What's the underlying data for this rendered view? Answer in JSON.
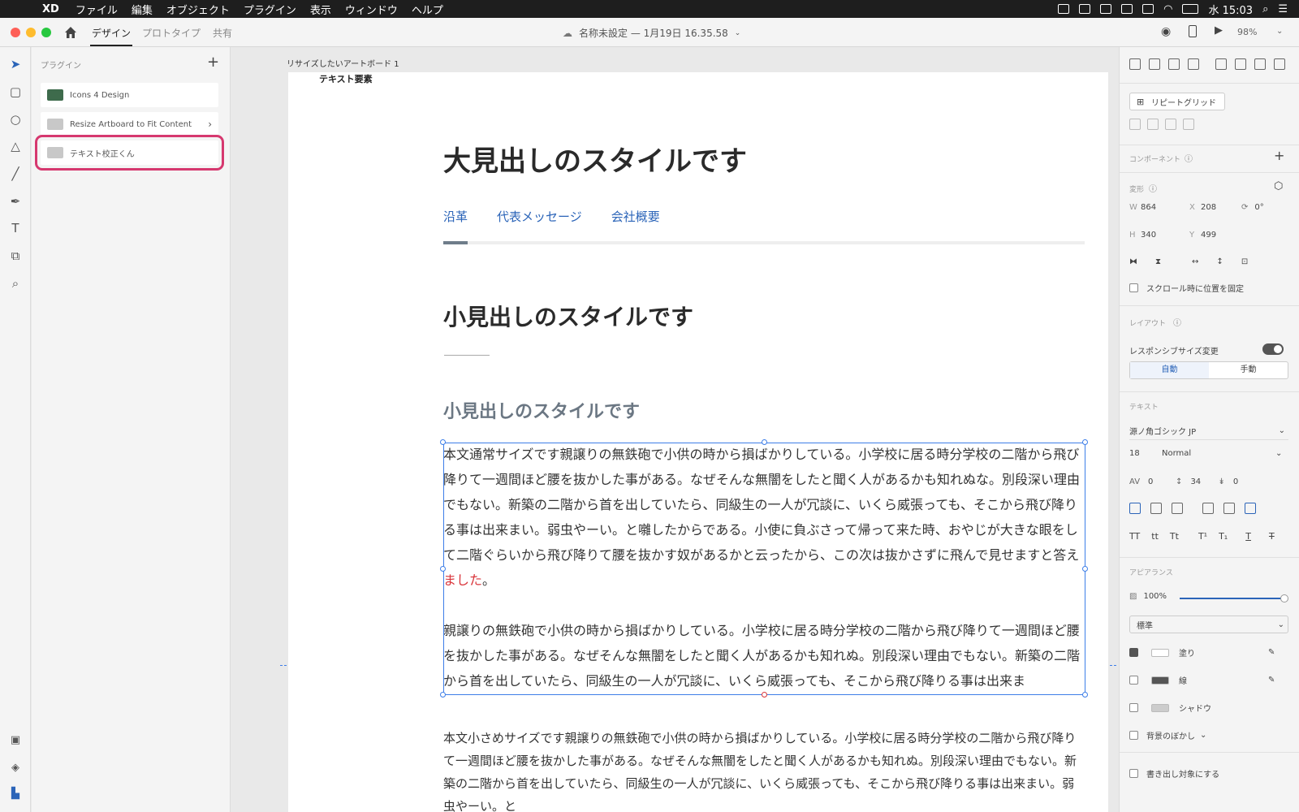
{
  "menubar": {
    "app": "XD",
    "items": [
      "ファイル",
      "編集",
      "オブジェクト",
      "プラグイン",
      "表示",
      "ウィンドウ",
      "ヘルプ"
    ],
    "clock": "水 15:03"
  },
  "titlebar": {
    "tabs": [
      "デザイン",
      "プロトタイプ",
      "共有"
    ],
    "doc_title": "名称未設定 — 1月19日 16.35.58",
    "zoom": "98%"
  },
  "plugins": {
    "header": "プラグイン",
    "items": [
      {
        "label": "Icons 4 Design"
      },
      {
        "label": "Resize Artboard to Fit Content",
        "chevron": "›"
      },
      {
        "label": "テキスト校正くん",
        "highlighted": true
      }
    ]
  },
  "canvas": {
    "artboard_label": "リサイズしたいアートボード 1",
    "text_element_label": "テキスト要素",
    "h1": "大見出しのスタイルです",
    "nav_links": [
      "沿革",
      "代表メッセージ",
      "会社概要"
    ],
    "h2": "小見出しのスタイルです",
    "h3": "小見出しのスタイルです",
    "body1_main": "本文通常サイズです親譲りの無鉄砲で小供の時から損ばかりしている。小学校に居る時分学校の二階から飛び降りて一週間ほど腰を抜かした事がある。なぜそんな無闇をしたと聞く人があるかも知れぬな。別段深い理由でもない。新築の二階から首を出していたら、同級生の一人が冗談に、いくら威張っても、そこから飛び降りる事は出来まい。弱虫やーい。と囃したからである。小使に負ぶさって帰って来た時、おやじが大きな眼をして二階ぐらいから飛び降りて腰を抜かす奴があるかと云ったから、この次は抜かさずに飛んで見せますと答え",
    "body1_red": "ました",
    "body1_end": "。",
    "body2": "親譲りの無鉄砲で小供の時から損ばかりしている。小学校に居る時分学校の二階から飛び降りて一週間ほど腰を抜かした事がある。なぜそんな無闇をしたと聞く人があるかも知れぬ。別段深い理由でもない。新築の二階から首を出していたら、同級生の一人が冗談に、いくら威張っても、そこから飛び降りる事は出来ま",
    "body_small": "本文小さめサイズです親譲りの無鉄砲で小供の時から損ばかりしている。小学校に居る時分学校の二階から飛び降りて一週間ほど腰を抜かした事がある。なぜそんな無闇をしたと聞く人があるかも知れぬ。別段深い理由でもない。新築の二階から首を出していたら、同級生の一人が冗談に、いくら威張っても、そこから飛び降りる事は出来まい。弱虫やーい。と"
  },
  "props": {
    "repeat_grid": "リピートグリッド",
    "component": "コンポーネント",
    "transform": "変形",
    "w_label": "W",
    "w": "864",
    "x_label": "X",
    "x": "208",
    "rotation": "0°",
    "h_label": "H",
    "h": "340",
    "y_label": "Y",
    "y": "499",
    "fix_on_scroll": "スクロール時に位置を固定",
    "layout": "レイアウト",
    "responsive": "レスポンシブサイズ変更",
    "auto": "自動",
    "manual": "手動",
    "text": "テキスト",
    "font": "源ノ角ゴシック JP",
    "font_size": "18",
    "font_weight": "Normal",
    "tracking": "0",
    "line_height": "34",
    "para_spacing": "0",
    "appearance": "アピアランス",
    "opacity": "100%",
    "blend": "標準",
    "fill": "塗り",
    "border": "線",
    "shadow": "シャドウ",
    "bg_blur": "背景のぼかし",
    "export": "書き出し対象にする"
  },
  "colors": {
    "accent": "#2b64b8",
    "highlight": "#d6386f",
    "selection": "#3d7ee8",
    "red_text": "#d9343a"
  }
}
